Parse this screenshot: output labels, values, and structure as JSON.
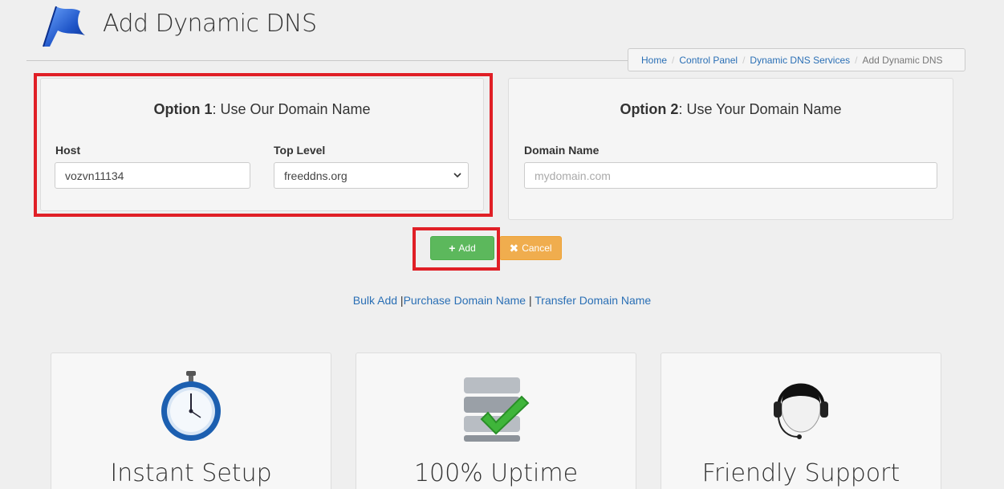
{
  "header": {
    "title": "Add Dynamic DNS",
    "logo_icon": "blue-flag-logo-icon"
  },
  "breadcrumb": [
    {
      "label": "Home"
    },
    {
      "label": "Control Panel"
    },
    {
      "label": "Dynamic DNS Services"
    },
    {
      "label": "Add Dynamic DNS"
    }
  ],
  "option1": {
    "heading_bold": "Option 1",
    "heading_rest": ": Use Our Domain Name",
    "host_label": "Host",
    "host_value": "vozvn11134",
    "top_level_label": "Top Level",
    "top_level_value": "freeddns.org"
  },
  "option2": {
    "heading_bold": "Option 2",
    "heading_rest": ": Use Your Domain Name",
    "domain_label": "Domain Name",
    "domain_placeholder": "mydomain.com",
    "domain_value": ""
  },
  "actions": {
    "add_label": "Add",
    "cancel_label": "Cancel"
  },
  "links": {
    "bulk_add": "Bulk Add",
    "purchase": "Purchase Domain Name",
    "transfer": "Transfer Domain Name",
    "pipe": "|"
  },
  "features": [
    {
      "title": "Instant Setup",
      "icon": "stopwatch-icon"
    },
    {
      "title": "100% Uptime",
      "icon": "database-check-icon"
    },
    {
      "title": "Friendly Support",
      "icon": "headset-support-icon"
    }
  ],
  "colors": {
    "highlight": "#e01f26",
    "add_button": "#5cb85c",
    "cancel_button": "#f0ad4e",
    "link": "#2a6fb5"
  }
}
